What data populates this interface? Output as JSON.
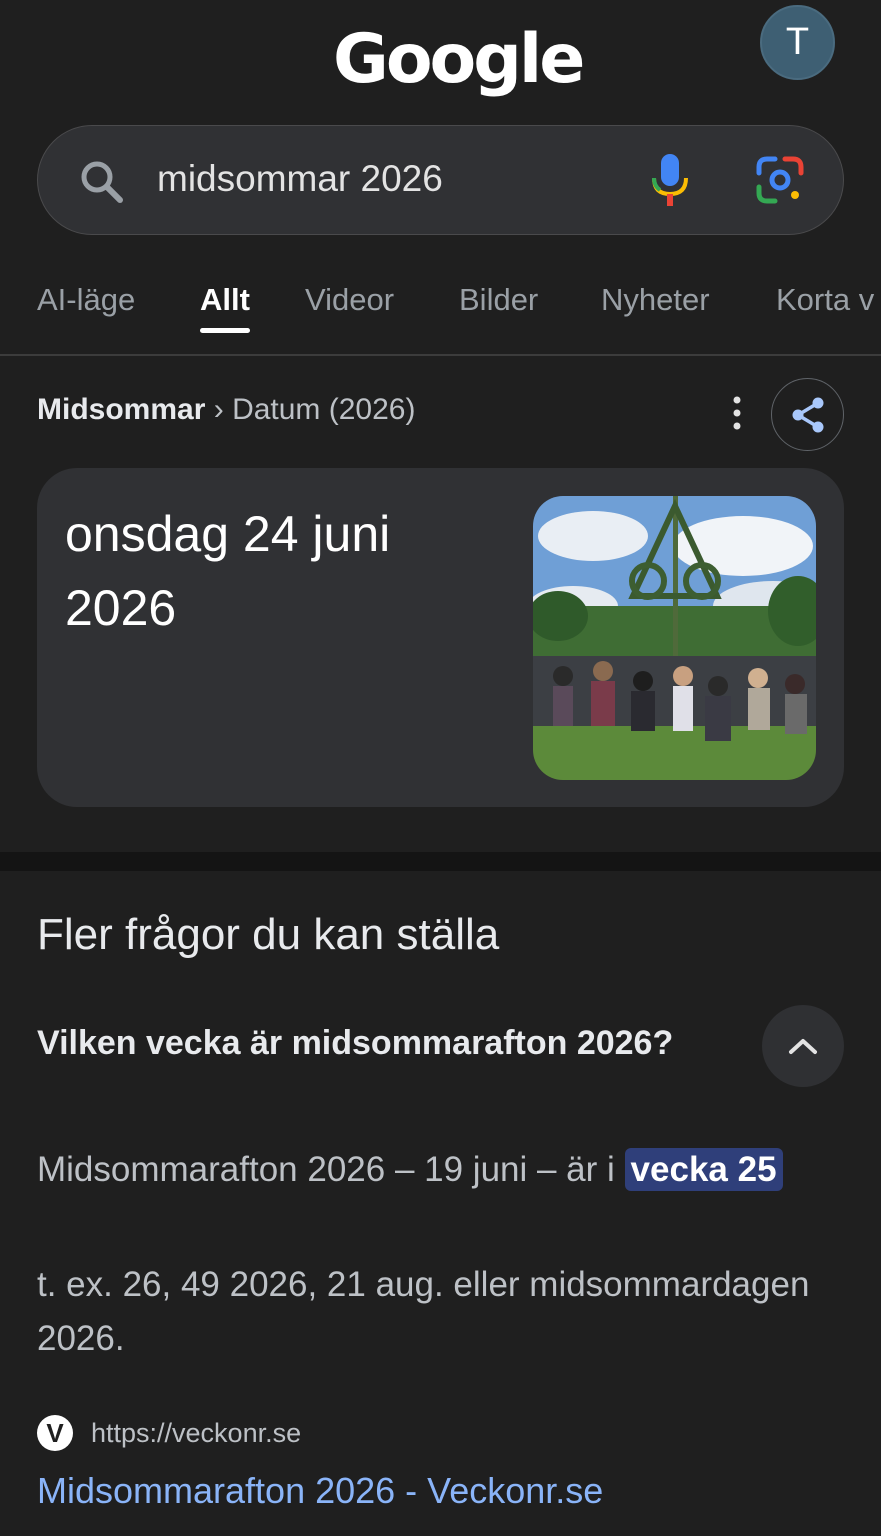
{
  "header": {
    "logo_text": "Google",
    "avatar_letter": "T"
  },
  "search": {
    "query": "midsommar 2026"
  },
  "tabs": [
    {
      "label": "AI-läge"
    },
    {
      "label": "Allt"
    },
    {
      "label": "Videor"
    },
    {
      "label": "Bilder"
    },
    {
      "label": "Nyheter"
    },
    {
      "label": "Korta v"
    }
  ],
  "answer_card": {
    "breadcrumb_root": "Midsommar",
    "breadcrumb_sep": "›",
    "breadcrumb_leaf": "Datum (2026)",
    "date_line1": "onsdag 24 juni",
    "date_line2": "2026"
  },
  "faq": {
    "heading": "Fler frågor du kan ställa",
    "question": "Vilken vecka är midsommarafton 2026?",
    "answer_prefix": "Midsommarafton 2026 – 19 juni – är i ",
    "answer_highlight": "vecka 25",
    "answer_more": "t. ex. 26, 49 2026, 21 aug. eller midsommardagen 2026.",
    "source_favicon": "V",
    "source_url": "https://veckonr.se",
    "result_title": "Midsommarafton 2026 - Veckonr.se"
  }
}
